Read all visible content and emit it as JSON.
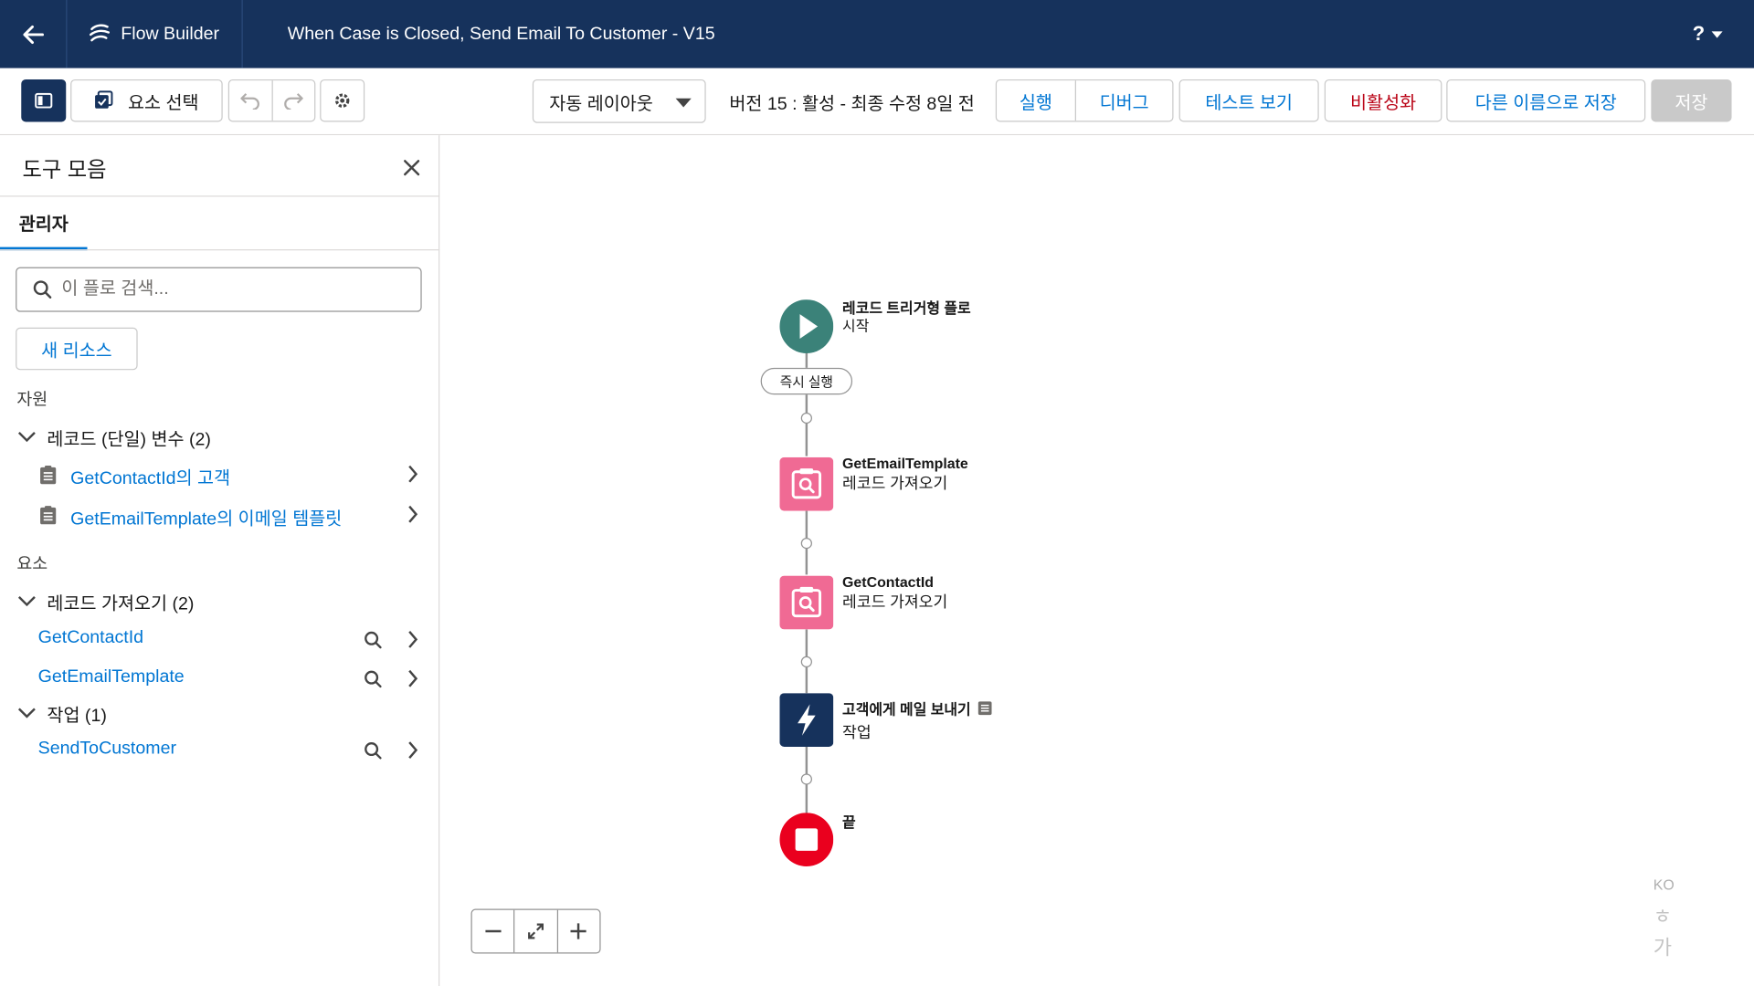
{
  "header": {
    "brand_name": "Flow Builder",
    "flow_title": "When Case is Closed, Send Email To Customer - V15",
    "help_label": "?"
  },
  "toolbar": {
    "select_elements_label": "요소 선택",
    "layout_select_value": "자동 레이아웃",
    "version_status": "버전 15 : 활성 - 최종 수정 8일 전",
    "run_label": "실행",
    "debug_label": "디버그",
    "view_tests_label": "테스트 보기",
    "deactivate_label": "비활성화",
    "save_as_label": "다른 이름으로 저장",
    "save_label": "저장"
  },
  "sidebar": {
    "title": "도구 모음",
    "tab_label": "관리자",
    "search_placeholder": "이 플로 검색...",
    "new_resource_label": "새 리소스",
    "resources_label": "자원",
    "record_vars_group": "레코드 (단일) 변수 (2)",
    "record_vars": [
      "GetContactId의 고객",
      "GetEmailTemplate의 이메일 템플릿"
    ],
    "elements_label": "요소",
    "get_records_group": "레코드 가져오기 (2)",
    "get_records": [
      "GetContactId",
      "GetEmailTemplate"
    ],
    "actions_group": "작업 (1)",
    "actions": [
      "SendToCustomer"
    ]
  },
  "canvas": {
    "start_title": "레코드 트리거형 플로",
    "start_sub": "시작",
    "run_immediately": "즉시 실행",
    "node1_title": "GetEmailTemplate",
    "node1_sub": "레코드 가져오기",
    "node2_title": "GetContactId",
    "node2_sub": "레코드 가져오기",
    "node3_title": "고객에게 메일 보내기",
    "node3_sub": "작업",
    "end_title": "끝"
  },
  "ime": {
    "lang": "KO",
    "glyph1": "ㅎ",
    "glyph2": "가"
  },
  "colors": {
    "header_bg": "#16325c",
    "start_node": "#3b8279",
    "get_records_node": "#f06a94",
    "action_node": "#16325c",
    "end_node": "#ea001e",
    "link": "#0176d3",
    "deactivate": "#ba0517"
  }
}
